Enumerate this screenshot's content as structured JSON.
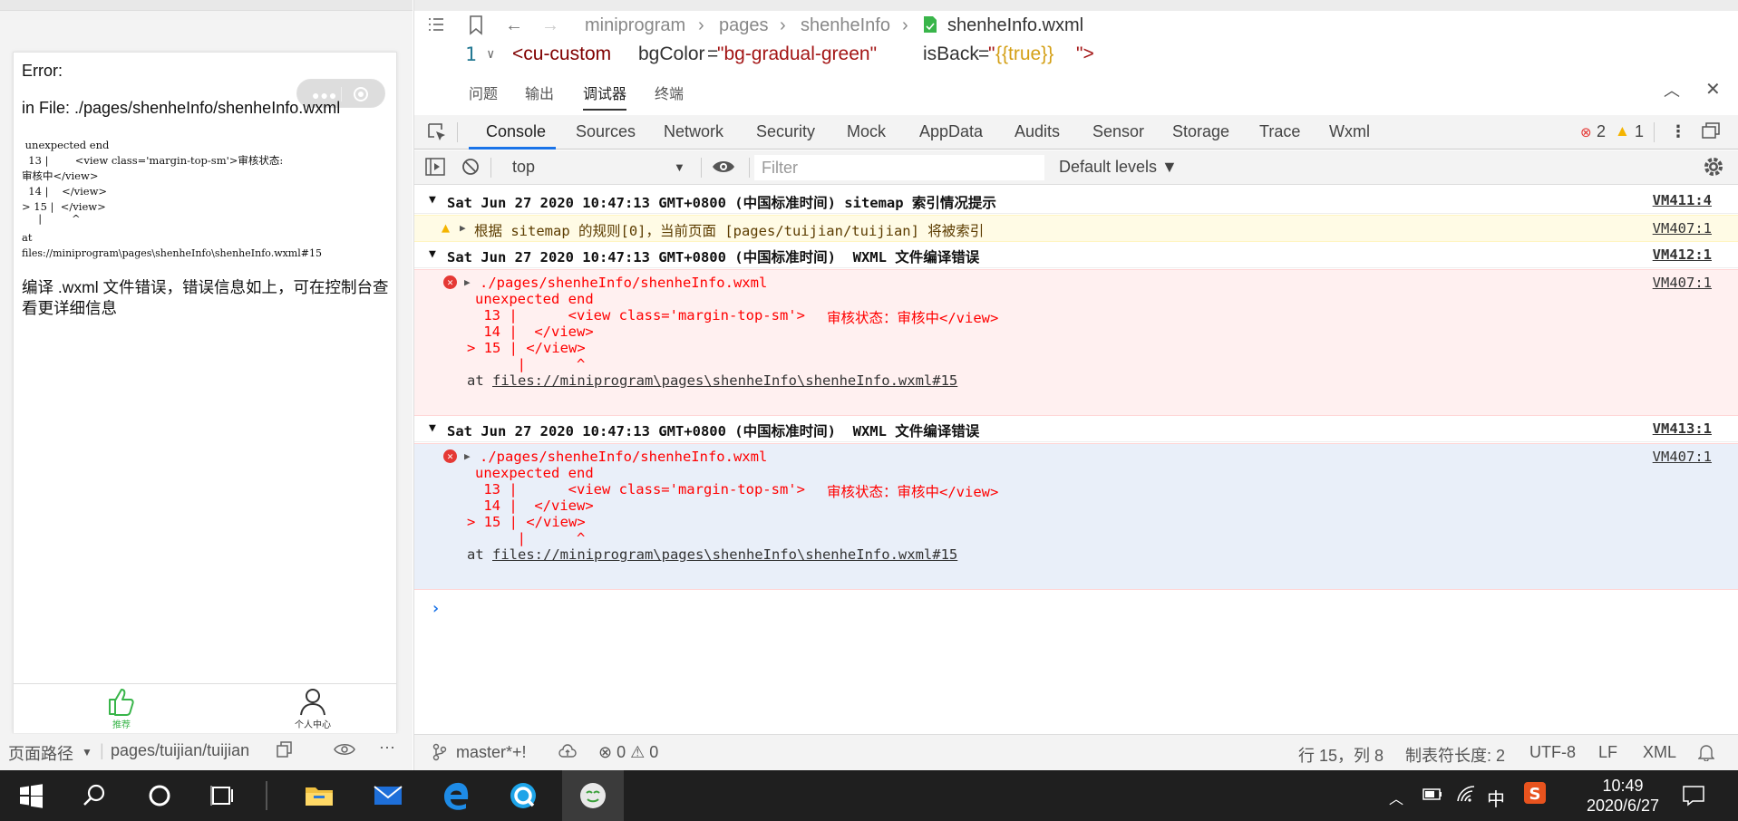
{
  "simulator": {
    "error_title": "Error:",
    "error_file": "in File: ./pages/shenheInfo/shenheInfo.wxml",
    "code_lines": [
      " unexpected end",
      "  13 |        <view class='margin-top-sm'>审核状态:",
      "审核中</view>",
      "  14 |    </view>",
      "> 15 |  </view>",
      "     |         ^",
      "at",
      "files://miniprogram\\pages\\shenheInfo\\shenheInfo.wxml#15"
    ],
    "message": "编译 .wxml 文件错误，错误信息如上，可在控制台查看更详细信息",
    "tabbar": {
      "recommend": "推荐",
      "profile": "个人中心"
    },
    "statusbar": {
      "path_label": "页面路径",
      "path_value": "pages/tuijian/tuijian"
    }
  },
  "editor": {
    "breadcrumb": [
      "miniprogram",
      "pages",
      "shenheInfo",
      "shenheInfo.wxml"
    ],
    "line_number": "1",
    "code": {
      "tag": "<cu-custom",
      "attr1": "bgColor",
      "eq1": "=",
      "val1": "\"bg-gradual-green\"",
      "attr2": "isBack",
      "eq2": "=",
      "val2_open": "\"",
      "val2": "{{true}}",
      "val2_close": "\">"
    }
  },
  "panel_tabs": [
    "问题",
    "输出",
    "调试器",
    "终端"
  ],
  "devtools_tabs": [
    "Console",
    "Sources",
    "Network",
    "Security",
    "Mock",
    "AppData",
    "Audits",
    "Sensor",
    "Storage",
    "Trace",
    "Wxml"
  ],
  "counts": {
    "errors": "2",
    "warnings": "1"
  },
  "console_toolbar": {
    "context": "top",
    "filter_placeholder": "Filter",
    "levels": "Default levels ▼"
  },
  "console": {
    "group1": {
      "header": "Sat Jun 27 2020 10:47:13 GMT+0800 (中国标准时间) sitemap 索引情况提示",
      "link": "VM411:4"
    },
    "warn": {
      "text": "根据 sitemap 的规则[0]，当前页面 [pages/tuijian/tuijian] 将被索引",
      "link": "VM407:1"
    },
    "group2": {
      "header": "Sat Jun 27 2020 10:47:13 GMT+0800 (中国标准时间)  WXML 文件编译错误",
      "link": "VM412:1"
    },
    "group3": {
      "header": "Sat Jun 27 2020 10:47:13 GMT+0800 (中国标准时间)  WXML 文件编译错误",
      "link": "VM413:1"
    },
    "error": {
      "file": "./pages/shenheInfo/shenheInfo.wxml",
      "l1": "unexpected end",
      "l2a": " 13 |      <view class='margin-top-sm'>",
      "l2b": "审核状态：审核中</view>",
      "l3": " 14 |  </view>",
      "l4": "> 15 | </view>",
      "l5": "     |      ^",
      "at": "at ",
      "at_link": "files://miniprogram\\pages\\shenheInfo\\shenheInfo.wxml#15",
      "link": "VM407:1"
    }
  },
  "ide_statusbar": {
    "branch": "master*+!",
    "problems": "⊗ 0 ⚠ 0",
    "position": "行 15，列 8",
    "tab_size": "制表符长度: 2",
    "encoding": "UTF-8",
    "eol": "LF",
    "language": "XML"
  },
  "taskbar": {
    "time": "10:49",
    "date": "2020/6/27",
    "ime": "中"
  },
  "colors": {
    "accent_blue": "#1a73e8",
    "green": "#39b54a",
    "error_red": "#e53935",
    "error_bg": "#fff0f0",
    "warn_bg": "#fffbe5",
    "taskbar_bg": "#1f1f1f"
  }
}
